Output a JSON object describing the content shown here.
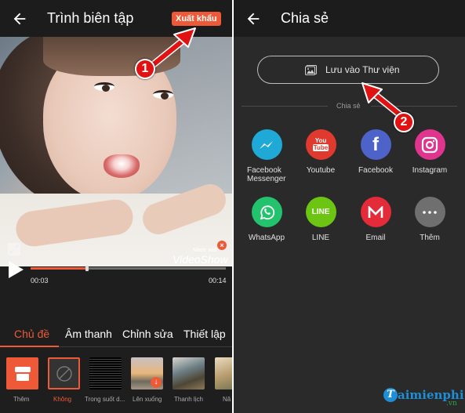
{
  "editor": {
    "title": "Trình biên tập",
    "export_label": "Xuất khẩu",
    "watermark": {
      "made_with": "Made with",
      "brand": "VideoShow"
    },
    "player": {
      "current_time": "00:03",
      "total_time": "00:14",
      "progress": 0.29
    },
    "tabs": [
      {
        "label": "Chủ đề",
        "active": true
      },
      {
        "label": "Âm thanh",
        "active": false
      },
      {
        "label": "Chỉnh sửa",
        "active": false
      },
      {
        "label": "Thiết lập",
        "active": false
      }
    ],
    "themes": [
      {
        "label": "Thêm",
        "icon": "store-icon"
      },
      {
        "label": "Không",
        "icon": "none-icon",
        "selected": true
      },
      {
        "label": "Trong suốt d..."
      },
      {
        "label": "Lên xuống",
        "icon": "download-icon"
      },
      {
        "label": "Thanh lịch"
      },
      {
        "label": "Nă"
      }
    ]
  },
  "share": {
    "title": "Chia sẻ",
    "save_label": "Lưu vào Thư viện",
    "section_label": "Chia sẻ",
    "apps": [
      {
        "label": "Facebook Messenger",
        "icon": "messenger-icon",
        "color": "#1fa9d6"
      },
      {
        "label": "Youtube",
        "icon": "youtube-icon",
        "color": "#e03a2e"
      },
      {
        "label": "Facebook",
        "icon": "facebook-icon",
        "color": "#4d63c9"
      },
      {
        "label": "Instagram",
        "icon": "instagram-icon",
        "color": "#e0358e"
      },
      {
        "label": "WhatsApp",
        "icon": "whatsapp-icon",
        "color": "#23c26d"
      },
      {
        "label": "LINE",
        "icon": "line-icon",
        "color": "#6cc413"
      },
      {
        "label": "Email",
        "icon": "email-icon",
        "color": "#e32b3a"
      },
      {
        "label": "Thêm",
        "icon": "more-icon",
        "color": "#6f6f6f"
      }
    ]
  },
  "annotations": {
    "step1": "1",
    "step2": "2"
  },
  "logo": {
    "name": "aimienphi",
    "initial": "T",
    "tld": ".vn"
  },
  "colors": {
    "accent": "#ee5a38",
    "annotation": "#e01212"
  }
}
